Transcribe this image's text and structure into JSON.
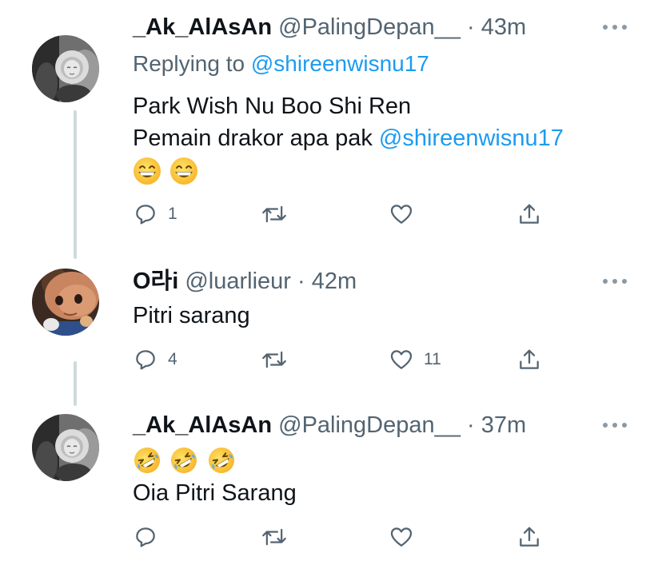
{
  "tweets": [
    {
      "display_name": "_Ak_AlAsAn",
      "handle": "@PalingDepan__",
      "separator": "·",
      "time": "43m",
      "replying_label": "Replying to",
      "replying_handle": "@shireenwisnu17",
      "line1": "Park Wish Nu Boo Shi Ren",
      "line2_text": "Pemain drakor apa pak",
      "line2_mention": "@shireenwisnu17",
      "emojis": [
        "grinning-face",
        "grinning-face"
      ],
      "actions": {
        "reply_count": "1",
        "retweet_count": "",
        "like_count": ""
      },
      "avatar_icon": "baby-photo-avatar"
    },
    {
      "display_name": "O라i",
      "handle": "@luarlieur",
      "separator": "·",
      "time": "42m",
      "text": "Pitri sarang",
      "actions": {
        "reply_count": "4",
        "retweet_count": "",
        "like_count": "11"
      },
      "avatar_icon": "cartoon-character-avatar"
    },
    {
      "display_name": "_Ak_AlAsAn",
      "handle": "@PalingDepan__",
      "separator": "·",
      "time": "37m",
      "emojis": [
        "rolling-on-floor-laughing",
        "rolling-on-floor-laughing",
        "rolling-on-floor-laughing"
      ],
      "text": "Oia Pitri Sarang",
      "actions": {
        "reply_count": "",
        "retweet_count": "",
        "like_count": ""
      },
      "avatar_icon": "baby-photo-avatar"
    }
  ],
  "colors": {
    "text": "#0f1419",
    "secondary": "#536471",
    "link": "#1d9bf0",
    "thread_line": "#cfd9de",
    "icon": "#536471"
  }
}
